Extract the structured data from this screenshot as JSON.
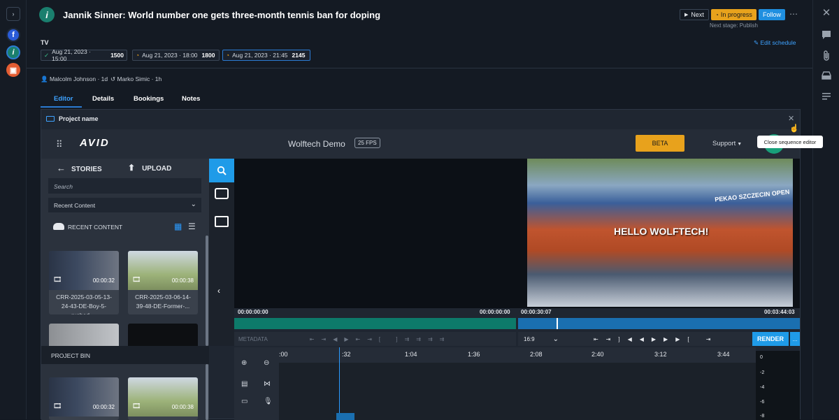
{
  "header": {
    "title": "Jannik Sinner: World number one gets three-month tennis ban for doping",
    "next_label": "Next",
    "status_label": "In progress",
    "follow_label": "Follow",
    "next_stage": "Next stage: Publish"
  },
  "channel": {
    "label": "TV",
    "edit_schedule": "Edit schedule",
    "slots": [
      {
        "date": "Aug 21, 2023 · 15:00",
        "code": "1500"
      },
      {
        "date": "Aug 21, 2023 · 18:00",
        "code": "1800"
      },
      {
        "date": "Aug 21, 2023 · 21:45",
        "code": "2145"
      }
    ]
  },
  "people": {
    "author": "Malcolm Johnson · 1d",
    "editor": "Marko Simic · 1h"
  },
  "tabs": [
    "Editor",
    "Details",
    "Bookings",
    "Notes"
  ],
  "project": {
    "name": "Project name",
    "tooltip": "Close sequence editor"
  },
  "avid": {
    "logo": "AVID",
    "project_title": "Wolftech Demo",
    "fps": "25 FPS",
    "beta": "BETA",
    "support": "Support"
  },
  "browser": {
    "stories": "STORIES",
    "upload": "UPLOAD",
    "search_placeholder": "Search",
    "content_select": "Recent Content",
    "recent_content": "RECENT CONTENT",
    "project_bin": "PROJECT BIN",
    "clips": [
      {
        "duration": "00:00:32",
        "caption": "CRR-2025-03-05-13-24-43-DE-Boy-5-rushed-..."
      },
      {
        "duration": "00:00:38",
        "caption": "CRR-2025-03-06-14-39-48-DE-Former-..."
      }
    ],
    "bin_clips": [
      {
        "duration": "00:00:32"
      },
      {
        "duration": "00:00:38"
      }
    ]
  },
  "viewers": {
    "source_in": "00:00:00:00",
    "source_out": "00:00:00:00",
    "record_in": "00:00:30:07",
    "record_out": "00:03:44:03",
    "overlay_text": "HELLO WOLFTECH!",
    "banner": "PEKAO SZCZECIN OPEN",
    "metadata": "METADATA",
    "aspect": "16:9",
    "render": "RENDER",
    "more": "..."
  },
  "timeline": {
    "ruler": [
      ":00",
      ":32",
      "1:04",
      "1:36",
      "2:08",
      "2:40",
      "3:12",
      "3:44"
    ],
    "meter": [
      "0",
      "-2",
      "-4",
      "-6",
      "-8"
    ]
  }
}
